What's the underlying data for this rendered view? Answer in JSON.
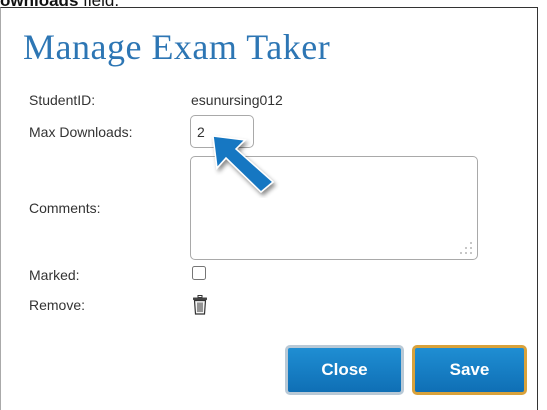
{
  "caption": {
    "bold": "ownloads",
    "rest": " field."
  },
  "dialog": {
    "title": "Manage Exam Taker",
    "fields": {
      "student_id_label": "StudentID:",
      "student_id_value": "esunursing012",
      "max_downloads_label": "Max Downloads:",
      "max_downloads_value": "2",
      "comments_label": "Comments:",
      "comments_value": "",
      "marked_label": "Marked:",
      "marked_checked": false,
      "remove_label": "Remove:"
    },
    "buttons": {
      "close": "Close",
      "save": "Save"
    }
  },
  "icons": {
    "remove": "trash-icon",
    "annotation": "arrow-pointer-icon",
    "resize": "resize-grip-icon"
  },
  "colors": {
    "title": "#2d76b4",
    "button": "#1777c2",
    "save_border": "#d9a23b",
    "arrow": "#1777c2"
  }
}
